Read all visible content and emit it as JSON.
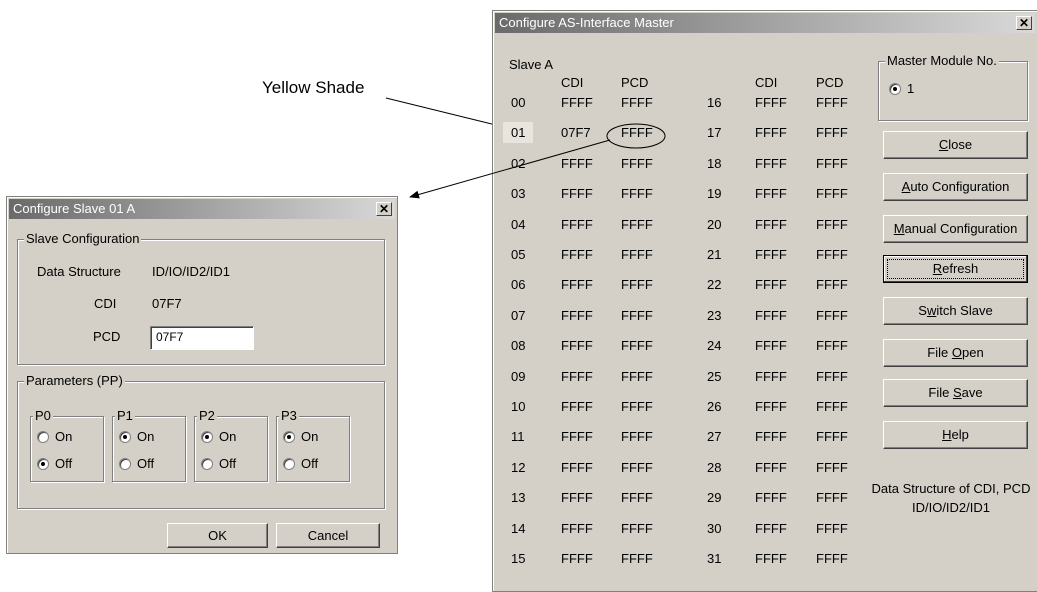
{
  "annotation": {
    "label": "Yellow Shade"
  },
  "master_window": {
    "title": "Configure AS-Interface Master",
    "slave_group_label": "Slave A",
    "col_cdi": "CDI",
    "col_pcd": "PCD",
    "highlighted_slave": "01",
    "rows_left": [
      {
        "id": "00",
        "cdi": "FFFF",
        "pcd": "FFFF"
      },
      {
        "id": "01",
        "cdi": "07F7",
        "pcd": "FFFF"
      },
      {
        "id": "02",
        "cdi": "FFFF",
        "pcd": "FFFF"
      },
      {
        "id": "03",
        "cdi": "FFFF",
        "pcd": "FFFF"
      },
      {
        "id": "04",
        "cdi": "FFFF",
        "pcd": "FFFF"
      },
      {
        "id": "05",
        "cdi": "FFFF",
        "pcd": "FFFF"
      },
      {
        "id": "06",
        "cdi": "FFFF",
        "pcd": "FFFF"
      },
      {
        "id": "07",
        "cdi": "FFFF",
        "pcd": "FFFF"
      },
      {
        "id": "08",
        "cdi": "FFFF",
        "pcd": "FFFF"
      },
      {
        "id": "09",
        "cdi": "FFFF",
        "pcd": "FFFF"
      },
      {
        "id": "10",
        "cdi": "FFFF",
        "pcd": "FFFF"
      },
      {
        "id": "11",
        "cdi": "FFFF",
        "pcd": "FFFF"
      },
      {
        "id": "12",
        "cdi": "FFFF",
        "pcd": "FFFF"
      },
      {
        "id": "13",
        "cdi": "FFFF",
        "pcd": "FFFF"
      },
      {
        "id": "14",
        "cdi": "FFFF",
        "pcd": "FFFF"
      },
      {
        "id": "15",
        "cdi": "FFFF",
        "pcd": "FFFF"
      }
    ],
    "rows_right": [
      {
        "id": "16",
        "cdi": "FFFF",
        "pcd": "FFFF"
      },
      {
        "id": "17",
        "cdi": "FFFF",
        "pcd": "FFFF"
      },
      {
        "id": "18",
        "cdi": "FFFF",
        "pcd": "FFFF"
      },
      {
        "id": "19",
        "cdi": "FFFF",
        "pcd": "FFFF"
      },
      {
        "id": "20",
        "cdi": "FFFF",
        "pcd": "FFFF"
      },
      {
        "id": "21",
        "cdi": "FFFF",
        "pcd": "FFFF"
      },
      {
        "id": "22",
        "cdi": "FFFF",
        "pcd": "FFFF"
      },
      {
        "id": "23",
        "cdi": "FFFF",
        "pcd": "FFFF"
      },
      {
        "id": "24",
        "cdi": "FFFF",
        "pcd": "FFFF"
      },
      {
        "id": "25",
        "cdi": "FFFF",
        "pcd": "FFFF"
      },
      {
        "id": "26",
        "cdi": "FFFF",
        "pcd": "FFFF"
      },
      {
        "id": "27",
        "cdi": "FFFF",
        "pcd": "FFFF"
      },
      {
        "id": "28",
        "cdi": "FFFF",
        "pcd": "FFFF"
      },
      {
        "id": "29",
        "cdi": "FFFF",
        "pcd": "FFFF"
      },
      {
        "id": "30",
        "cdi": "FFFF",
        "pcd": "FFFF"
      },
      {
        "id": "31",
        "cdi": "FFFF",
        "pcd": "FFFF"
      }
    ],
    "master_module": {
      "label": "Master Module No.",
      "option": "1",
      "selected": true
    },
    "buttons": [
      {
        "name": "close-button",
        "pre": "",
        "u": "C",
        "post": "lose",
        "focused": false
      },
      {
        "name": "auto-configuration-button",
        "pre": "",
        "u": "A",
        "post": "uto Configuration",
        "focused": false
      },
      {
        "name": "manual-configuration-button",
        "pre": "",
        "u": "M",
        "post": "anual Configuration",
        "focused": false
      },
      {
        "name": "refresh-button",
        "pre": "",
        "u": "R",
        "post": "efresh",
        "focused": true
      },
      {
        "name": "switch-slave-button",
        "pre": "S",
        "u": "w",
        "post": "itch Slave",
        "focused": false
      },
      {
        "name": "file-open-button",
        "pre": "File ",
        "u": "O",
        "post": "pen",
        "focused": false
      },
      {
        "name": "file-save-button",
        "pre": "File ",
        "u": "S",
        "post": "ave",
        "focused": false
      },
      {
        "name": "help-button",
        "pre": "",
        "u": "H",
        "post": "elp",
        "focused": false
      }
    ],
    "info_line1": "Data Structure of CDI, PCD",
    "info_line2": "ID/IO/ID2/ID1"
  },
  "slave_dialog": {
    "title": "Configure Slave 01 A",
    "config_group_label": "Slave Configuration",
    "data_structure_label": "Data Structure",
    "data_structure_value": "ID/IO/ID2/ID1",
    "cdi_label": "CDI",
    "cdi_value": "07F7",
    "pcd_label": "PCD",
    "pcd_value": "07F7",
    "params_group_label": "Parameters (PP)",
    "on_label": "On",
    "off_label": "Off",
    "params": [
      {
        "name": "P0",
        "on": false
      },
      {
        "name": "P1",
        "on": true
      },
      {
        "name": "P2",
        "on": true
      },
      {
        "name": "P3",
        "on": true
      }
    ],
    "ok_label": "OK",
    "cancel_label": "Cancel"
  },
  "colors": {
    "window_bg": "#d4d0c8",
    "highlight": "#e8e4de"
  }
}
